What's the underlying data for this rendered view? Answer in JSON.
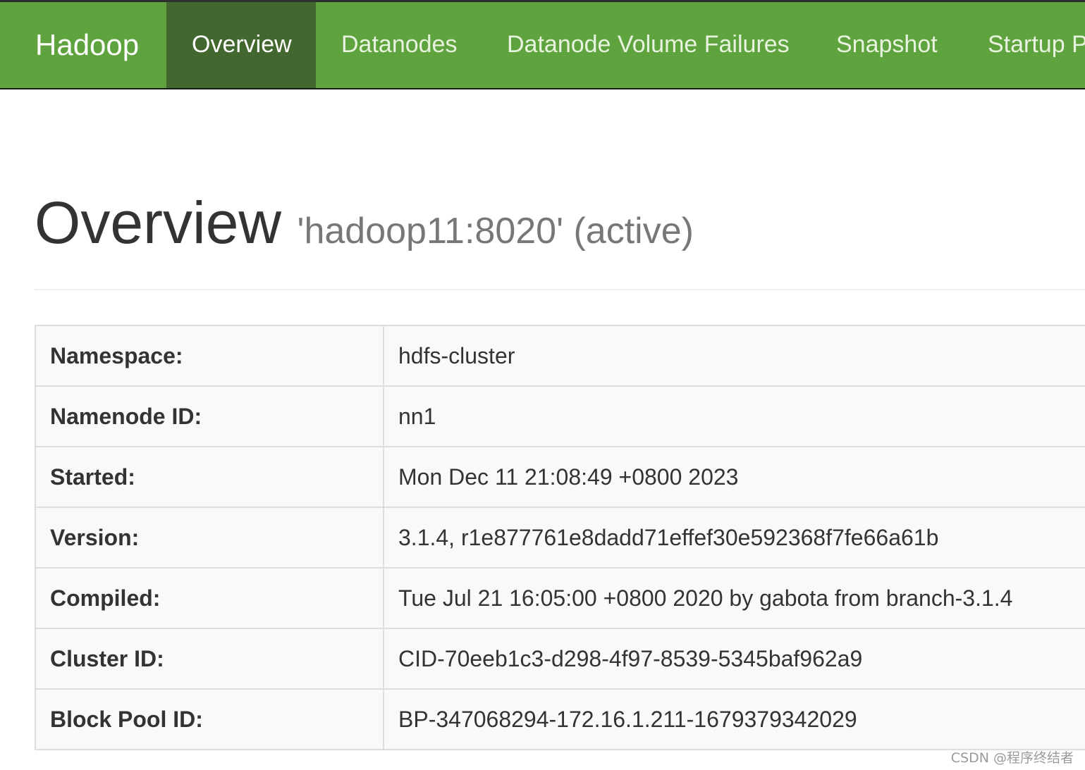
{
  "navbar": {
    "brand": "Hadoop",
    "items": [
      {
        "label": "Overview",
        "active": true
      },
      {
        "label": "Datanodes",
        "active": false
      },
      {
        "label": "Datanode Volume Failures",
        "active": false
      },
      {
        "label": "Snapshot",
        "active": false
      },
      {
        "label": "Startup P",
        "active": false
      }
    ],
    "colors": {
      "bar": "#5fa33e",
      "active": "#43682f"
    }
  },
  "page": {
    "title": "Overview",
    "subtitle": "'hadoop11:8020' (active)"
  },
  "info_table": [
    {
      "key": "Namespace:",
      "value": "hdfs-cluster"
    },
    {
      "key": "Namenode ID:",
      "value": "nn1"
    },
    {
      "key": "Started:",
      "value": "Mon Dec 11 21:08:49 +0800 2023"
    },
    {
      "key": "Version:",
      "value": "3.1.4, r1e877761e8dadd71effef30e592368f7fe66a61b"
    },
    {
      "key": "Compiled:",
      "value": "Tue Jul 21 16:05:00 +0800 2020 by gabota from branch-3.1.4"
    },
    {
      "key": "Cluster ID:",
      "value": "CID-70eeb1c3-d298-4f97-8539-5345baf962a9"
    },
    {
      "key": "Block Pool ID:",
      "value": "BP-347068294-172.16.1.211-1679379342029"
    }
  ],
  "watermark": "CSDN @程序终结者"
}
